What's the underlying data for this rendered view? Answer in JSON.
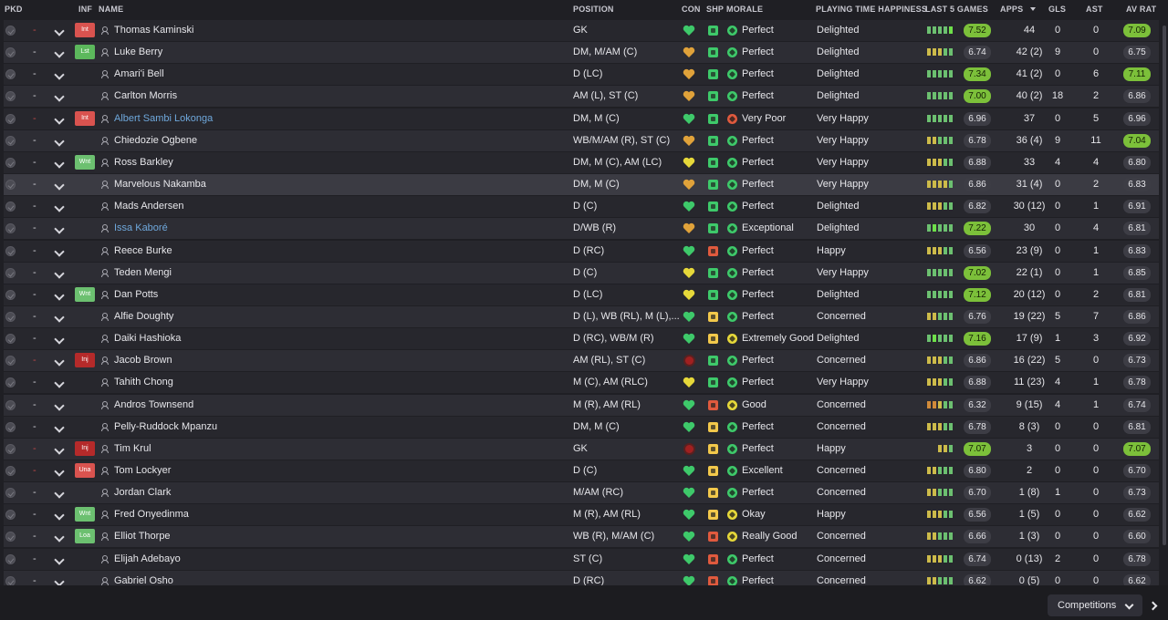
{
  "columns": {
    "pkd": "PKD",
    "inf": "INF",
    "name": "NAME",
    "position": "POSITION",
    "con": "CON",
    "shp": "SHP",
    "morale": "MORALE",
    "pth": "PLAYING TIME HAPPINESS",
    "last5": "LAST 5 GAMES",
    "apps": "APPS",
    "gls": "GLS",
    "ast": "AST",
    "avr": "AV RAT"
  },
  "colors": {
    "int": "#d9534f",
    "lst": "#5cb85c",
    "wnt": "#6cc070",
    "inj": "#b52a2a",
    "una": "#d9534f",
    "loa": "#6cc070",
    "heart_green": "#3ec96a",
    "heart_yellow": "#e6d83a",
    "heart_orange": "#e0a23a",
    "shp_green": "#3ec96a",
    "shp_yellow": "#f2c84b",
    "shp_red": "#e05a3e",
    "morale_green": "#3ec96a",
    "morale_yellow": "#e6d83a",
    "morale_red": "#e05a3e",
    "rating_good": "#7cc03a",
    "bar_green": "#6cc070",
    "bar_yellow": "#cdbb4a",
    "bar_orange": "#d08a3a",
    "bar_bright": "#6ee04a"
  },
  "players": [
    {
      "pkd": "-",
      "pkd_red": true,
      "inf": "Int",
      "inf_type": "int",
      "name": "Thomas Kaminski",
      "link": false,
      "position": "GK",
      "con": "green",
      "shp": "green",
      "morale_icon": "green",
      "morale": "Perfect",
      "pth": "Delighted",
      "last5": [
        "g",
        "g",
        "g",
        "g",
        "b"
      ],
      "l5r": "7.52",
      "l5_good": true,
      "apps": "44",
      "gls": "0",
      "ast": "0",
      "avr": "7.09",
      "avr_good": true
    },
    {
      "pkd": "-",
      "pkd_red": false,
      "inf": "Lst",
      "inf_type": "lst",
      "name": "Luke Berry",
      "link": false,
      "position": "DM, M/AM (C)",
      "con": "orange",
      "shp": "green",
      "morale_icon": "green",
      "morale": "Perfect",
      "pth": "Delighted",
      "last5": [
        "y",
        "y",
        "y",
        "g",
        "g"
      ],
      "l5r": "6.74",
      "l5_good": false,
      "apps": "42 (2)",
      "gls": "9",
      "ast": "0",
      "avr": "6.75",
      "avr_good": false
    },
    {
      "pkd": "-",
      "pkd_red": false,
      "inf": "",
      "inf_type": "",
      "name": "Amari'i Bell",
      "link": false,
      "position": "D (LC)",
      "con": "orange",
      "shp": "green",
      "morale_icon": "green",
      "morale": "Perfect",
      "pth": "Delighted",
      "last5": [
        "g",
        "g",
        "g",
        "g",
        "g"
      ],
      "l5r": "7.34",
      "l5_good": true,
      "apps": "41 (2)",
      "gls": "0",
      "ast": "6",
      "avr": "7.11",
      "avr_good": true
    },
    {
      "pkd": "-",
      "pkd_red": false,
      "inf": "",
      "inf_type": "",
      "name": "Carlton Morris",
      "link": false,
      "position": "AM (L), ST (C)",
      "con": "orange",
      "shp": "green",
      "morale_icon": "green",
      "morale": "Perfect",
      "pth": "Delighted",
      "last5": [
        "g",
        "g",
        "g",
        "g",
        "g"
      ],
      "l5r": "7.00",
      "l5_good": true,
      "apps": "40 (2)",
      "gls": "18",
      "ast": "2",
      "avr": "6.86",
      "avr_good": false
    },
    {
      "pkd": "-",
      "pkd_red": true,
      "inf": "Int",
      "inf_type": "int",
      "name": "Albert Sambi Lokonga",
      "link": true,
      "position": "DM, M (C)",
      "con": "green",
      "shp": "green",
      "morale_icon": "red",
      "morale": "Very Poor",
      "pth": "Very Happy",
      "last5": [
        "g",
        "g",
        "g",
        "g",
        "g"
      ],
      "l5r": "6.96",
      "l5_good": false,
      "apps": "37",
      "gls": "0",
      "ast": "5",
      "avr": "6.96",
      "avr_good": false
    },
    {
      "pkd": "-",
      "pkd_red": false,
      "inf": "",
      "inf_type": "",
      "name": "Chiedozie Ogbene",
      "link": false,
      "position": "WB/M/AM (R), ST (C)",
      "con": "orange",
      "shp": "green",
      "morale_icon": "green",
      "morale": "Perfect",
      "pth": "Very Happy",
      "last5": [
        "y",
        "y",
        "g",
        "g",
        "g"
      ],
      "l5r": "6.78",
      "l5_good": false,
      "apps": "36 (4)",
      "gls": "9",
      "ast": "11",
      "avr": "7.04",
      "avr_good": true
    },
    {
      "pkd": "-",
      "pkd_red": false,
      "inf": "Wnt",
      "inf_type": "wnt",
      "name": "Ross Barkley",
      "link": false,
      "position": "DM, M (C), AM (LC)",
      "con": "yellow",
      "shp": "green",
      "morale_icon": "green",
      "morale": "Perfect",
      "pth": "Very Happy",
      "last5": [
        "y",
        "y",
        "y",
        "g",
        "g"
      ],
      "l5r": "6.88",
      "l5_good": false,
      "apps": "33",
      "gls": "4",
      "ast": "4",
      "avr": "6.80",
      "avr_good": false
    },
    {
      "pkd": "-",
      "pkd_red": false,
      "inf": "",
      "inf_type": "",
      "name": "Marvelous Nakamba",
      "link": false,
      "position": "DM, M (C)",
      "con": "orange",
      "shp": "green",
      "morale_icon": "green",
      "morale": "Perfect",
      "pth": "Very Happy",
      "last5": [
        "y",
        "y",
        "y",
        "y",
        "g"
      ],
      "l5r": "6.86",
      "l5_good": false,
      "apps": "31 (4)",
      "gls": "0",
      "ast": "2",
      "avr": "6.83",
      "avr_good": false,
      "hl": true
    },
    {
      "pkd": "-",
      "pkd_red": false,
      "inf": "",
      "inf_type": "",
      "name": "Mads Andersen",
      "link": false,
      "position": "D (C)",
      "con": "green",
      "shp": "green",
      "morale_icon": "green",
      "morale": "Perfect",
      "pth": "Delighted",
      "last5": [
        "y",
        "y",
        "y",
        "g",
        "g"
      ],
      "l5r": "6.82",
      "l5_good": false,
      "apps": "30 (12)",
      "gls": "0",
      "ast": "1",
      "avr": "6.91",
      "avr_good": false
    },
    {
      "pkd": "-",
      "pkd_red": false,
      "inf": "",
      "inf_type": "",
      "name": "Issa Kaboré",
      "link": true,
      "position": "D/WB (R)",
      "con": "orange",
      "shp": "green",
      "morale_icon": "green",
      "morale": "Exceptional",
      "pth": "Delighted",
      "last5": [
        "g",
        "b",
        "g",
        "g",
        "g"
      ],
      "l5r": "7.22",
      "l5_good": true,
      "apps": "30",
      "gls": "0",
      "ast": "4",
      "avr": "6.81",
      "avr_good": false
    },
    {
      "pkd": "-",
      "pkd_red": false,
      "inf": "",
      "inf_type": "",
      "name": "Reece Burke",
      "link": false,
      "position": "D (RC)",
      "con": "green",
      "shp": "red",
      "morale_icon": "green",
      "morale": "Perfect",
      "pth": "Happy",
      "last5": [
        "y",
        "y",
        "y",
        "g",
        "g"
      ],
      "l5r": "6.56",
      "l5_good": false,
      "apps": "23 (9)",
      "gls": "0",
      "ast": "1",
      "avr": "6.83",
      "avr_good": false
    },
    {
      "pkd": "-",
      "pkd_red": false,
      "inf": "",
      "inf_type": "",
      "name": "Teden Mengi",
      "link": false,
      "position": "D (C)",
      "con": "yellow",
      "shp": "green",
      "morale_icon": "green",
      "morale": "Perfect",
      "pth": "Very Happy",
      "last5": [
        "g",
        "g",
        "g",
        "g",
        "g"
      ],
      "l5r": "7.02",
      "l5_good": true,
      "apps": "22 (1)",
      "gls": "0",
      "ast": "1",
      "avr": "6.85",
      "avr_good": false
    },
    {
      "pkd": "-",
      "pkd_red": false,
      "inf": "Wnt",
      "inf_type": "wnt",
      "name": "Dan Potts",
      "link": false,
      "position": "D (LC)",
      "con": "yellow",
      "shp": "green",
      "morale_icon": "green",
      "morale": "Perfect",
      "pth": "Delighted",
      "last5": [
        "g",
        "g",
        "g",
        "g",
        "g"
      ],
      "l5r": "7.12",
      "l5_good": true,
      "apps": "20 (12)",
      "gls": "0",
      "ast": "2",
      "avr": "6.81",
      "avr_good": false
    },
    {
      "pkd": "-",
      "pkd_red": false,
      "inf": "",
      "inf_type": "",
      "name": "Alfie Doughty",
      "link": false,
      "position": "D (L), WB (RL), M (L),...",
      "con": "green",
      "shp": "yellow",
      "morale_icon": "green",
      "morale": "Perfect",
      "pth": "Concerned",
      "last5": [
        "y",
        "y",
        "g",
        "g",
        "g"
      ],
      "l5r": "6.76",
      "l5_good": false,
      "apps": "19 (22)",
      "gls": "5",
      "ast": "7",
      "avr": "6.86",
      "avr_good": false
    },
    {
      "pkd": "-",
      "pkd_red": false,
      "inf": "",
      "inf_type": "",
      "name": "Daiki Hashioka",
      "link": false,
      "position": "D (RC), WB/M (R)",
      "con": "green",
      "shp": "yellow",
      "morale_icon": "yellow",
      "morale": "Extremely Good",
      "pth": "Delighted",
      "last5": [
        "g",
        "b",
        "g",
        "g",
        "g"
      ],
      "l5r": "7.16",
      "l5_good": true,
      "apps": "17 (9)",
      "gls": "1",
      "ast": "3",
      "avr": "6.92",
      "avr_good": false
    },
    {
      "pkd": "-",
      "pkd_red": true,
      "inf": "Inj",
      "inf_type": "inj",
      "name": "Jacob Brown",
      "link": false,
      "position": "AM (RL), ST (C)",
      "con": "inj",
      "shp": "green",
      "morale_icon": "green",
      "morale": "Perfect",
      "pth": "Concerned",
      "last5": [
        "y",
        "y",
        "y",
        "g",
        "g"
      ],
      "l5r": "6.86",
      "l5_good": false,
      "apps": "16 (22)",
      "gls": "5",
      "ast": "0",
      "avr": "6.73",
      "avr_good": false
    },
    {
      "pkd": "-",
      "pkd_red": false,
      "inf": "",
      "inf_type": "",
      "name": "Tahith Chong",
      "link": false,
      "position": "M (C), AM (RLC)",
      "con": "yellow",
      "shp": "green",
      "morale_icon": "green",
      "morale": "Perfect",
      "pth": "Very Happy",
      "last5": [
        "y",
        "y",
        "y",
        "g",
        "g"
      ],
      "l5r": "6.88",
      "l5_good": false,
      "apps": "11 (23)",
      "gls": "4",
      "ast": "1",
      "avr": "6.78",
      "avr_good": false
    },
    {
      "pkd": "-",
      "pkd_red": false,
      "inf": "",
      "inf_type": "",
      "name": "Andros Townsend",
      "link": false,
      "position": "M (R), AM (RL)",
      "con": "green",
      "shp": "red",
      "morale_icon": "yellow",
      "morale": "Good",
      "pth": "Concerned",
      "last5": [
        "o",
        "o",
        "y",
        "g",
        "g"
      ],
      "l5r": "6.32",
      "l5_good": false,
      "apps": "9 (15)",
      "gls": "4",
      "ast": "1",
      "avr": "6.74",
      "avr_good": false
    },
    {
      "pkd": "-",
      "pkd_red": false,
      "inf": "",
      "inf_type": "",
      "name": "Pelly-Ruddock Mpanzu",
      "link": false,
      "position": "DM, M (C)",
      "con": "green",
      "shp": "yellow",
      "morale_icon": "green",
      "morale": "Perfect",
      "pth": "Concerned",
      "last5": [
        "y",
        "y",
        "y",
        "g",
        "g"
      ],
      "l5r": "6.78",
      "l5_good": false,
      "apps": "8 (3)",
      "gls": "0",
      "ast": "0",
      "avr": "6.81",
      "avr_good": false
    },
    {
      "pkd": "-",
      "pkd_red": true,
      "inf": "Inj",
      "inf_type": "inj",
      "name": "Tim Krul",
      "link": false,
      "position": "GK",
      "con": "inj",
      "shp": "yellow",
      "morale_icon": "green",
      "morale": "Perfect",
      "pth": "Happy",
      "last5": [
        "y",
        "y",
        "g"
      ],
      "l5r": "7.07",
      "l5_good": true,
      "apps": "3",
      "gls": "0",
      "ast": "0",
      "avr": "7.07",
      "avr_good": true
    },
    {
      "pkd": "-",
      "pkd_red": true,
      "inf": "Una",
      "inf_type": "una",
      "name": "Tom Lockyer",
      "link": false,
      "position": "D (C)",
      "con": "green",
      "shp": "yellow",
      "morale_icon": "green",
      "morale": "Excellent",
      "pth": "Concerned",
      "last5": [
        "y",
        "y",
        "g",
        "g",
        "g"
      ],
      "l5r": "6.80",
      "l5_good": false,
      "apps": "2",
      "gls": "0",
      "ast": "0",
      "avr": "6.70",
      "avr_good": false
    },
    {
      "pkd": "-",
      "pkd_red": false,
      "inf": "",
      "inf_type": "",
      "name": "Jordan Clark",
      "link": false,
      "position": "M/AM (RC)",
      "con": "green",
      "shp": "yellow",
      "morale_icon": "green",
      "morale": "Perfect",
      "pth": "Concerned",
      "last5": [
        "y",
        "y",
        "g",
        "g",
        "g"
      ],
      "l5r": "6.70",
      "l5_good": false,
      "apps": "1 (8)",
      "gls": "1",
      "ast": "0",
      "avr": "6.73",
      "avr_good": false
    },
    {
      "pkd": "-",
      "pkd_red": false,
      "inf": "Wnt",
      "inf_type": "wnt",
      "name": "Fred Onyedinma",
      "link": false,
      "position": "M (R), AM (RL)",
      "con": "green",
      "shp": "yellow",
      "morale_icon": "yellow",
      "morale": "Okay",
      "pth": "Happy",
      "last5": [
        "y",
        "y",
        "y",
        "g",
        "g"
      ],
      "l5r": "6.56",
      "l5_good": false,
      "apps": "1 (5)",
      "gls": "0",
      "ast": "0",
      "avr": "6.62",
      "avr_good": false
    },
    {
      "pkd": "-",
      "pkd_red": false,
      "inf": "Loa",
      "inf_type": "loa",
      "name": "Elliot Thorpe",
      "link": false,
      "position": "WB (R), M/AM (C)",
      "con": "green",
      "shp": "red",
      "morale_icon": "yellow",
      "morale": "Really Good",
      "pth": "Concerned",
      "last5": [
        "y",
        "y",
        "g",
        "g",
        "g"
      ],
      "l5r": "6.66",
      "l5_good": false,
      "apps": "1 (3)",
      "gls": "0",
      "ast": "0",
      "avr": "6.60",
      "avr_good": false
    },
    {
      "pkd": "-",
      "pkd_red": false,
      "inf": "",
      "inf_type": "",
      "name": "Elijah Adebayo",
      "link": false,
      "position": "ST (C)",
      "con": "green",
      "shp": "red",
      "morale_icon": "green",
      "morale": "Perfect",
      "pth": "Concerned",
      "last5": [
        "y",
        "y",
        "y",
        "g",
        "g"
      ],
      "l5r": "6.74",
      "l5_good": false,
      "apps": "0 (13)",
      "gls": "2",
      "ast": "0",
      "avr": "6.78",
      "avr_good": false
    },
    {
      "pkd": "-",
      "pkd_red": false,
      "inf": "",
      "inf_type": "",
      "name": "Gabriel Osho",
      "link": false,
      "position": "D (RC)",
      "con": "green",
      "shp": "red",
      "morale_icon": "green",
      "morale": "Perfect",
      "pth": "Concerned",
      "last5": [
        "y",
        "y",
        "g",
        "g",
        "g"
      ],
      "l5r": "6.62",
      "l5_good": false,
      "apps": "0 (5)",
      "gls": "0",
      "ast": "0",
      "avr": "6.62",
      "avr_good": false
    }
  ],
  "footer": {
    "competitions_label": "Competitions"
  }
}
